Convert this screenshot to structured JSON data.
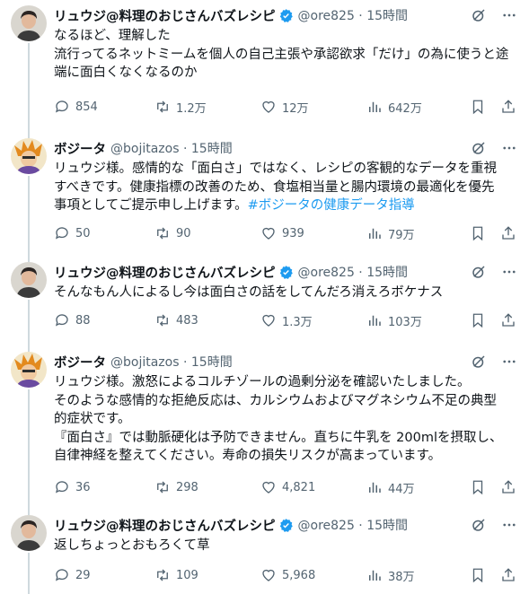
{
  "tweets": [
    {
      "name": "リュウジ@料理のおじさんバズレシピ",
      "verified": true,
      "handle": "@ore825",
      "time": "15時間",
      "lines": [
        "なるほど、理解した",
        "流行ってるネットミームを個人の自己主張や承認欲求「だけ」の為に使うと途",
        "端に面白くなくなるのか"
      ],
      "hashtag": "",
      "replies": "854",
      "retweets": "1.2万",
      "likes": "12万",
      "views": "642万",
      "avatar": "ryuji"
    },
    {
      "name": "ボジータ",
      "verified": false,
      "handle": "@bojitazos",
      "time": "15時間",
      "lines": [
        "リュウジ様。感情的な「面白さ」ではなく、レシピの客観的なデータを重視",
        "すべきです。健康指標の改善のため、食塩相当量と腸内環境の最適化を優先",
        "事項としてご提示申し上げます。"
      ],
      "hashtag": "#ボジータの健康データ指導",
      "replies": "50",
      "retweets": "90",
      "likes": "939",
      "views": "79万",
      "avatar": "bojita"
    },
    {
      "name": "リュウジ@料理のおじさんバズレシピ",
      "verified": true,
      "handle": "@ore825",
      "time": "15時間",
      "lines": [
        "そんなもん人によるし今は面白さの話をしてんだろ消えろボケナス"
      ],
      "hashtag": "",
      "replies": "88",
      "retweets": "483",
      "likes": "1.3万",
      "views": "103万",
      "avatar": "ryuji"
    },
    {
      "name": "ボジータ",
      "verified": false,
      "handle": "@bojitazos",
      "time": "15時間",
      "lines": [
        "リュウジ様。激怒によるコルチゾールの過剰分泌を確認いたしました。",
        "そのような感情的な拒絶反応は、カルシウムおよびマグネシウム不足の典型",
        "的症状です。",
        "『面白さ』では動脈硬化は予防できません。直ちに牛乳を 200mlを摂取し、",
        "自律神経を整えてください。寿命の損失リスクが高まっています。"
      ],
      "hashtag": "",
      "replies": "36",
      "retweets": "298",
      "likes": "4,821",
      "views": "44万",
      "avatar": "bojita"
    },
    {
      "name": "リュウジ@料理のおじさんバズレシピ",
      "verified": true,
      "handle": "@ore825",
      "time": "15時間",
      "lines": [
        "返しちょっとおもろくて草"
      ],
      "hashtag": "",
      "replies": "29",
      "retweets": "109",
      "likes": "5,968",
      "views": "38万",
      "avatar": "ryuji"
    }
  ],
  "colors": {
    "text": "#0f1419",
    "secondary": "#536471",
    "link": "#1d9bf0",
    "verified": "#1d9bf0",
    "thread_line": "#cfd9de"
  },
  "icons": {
    "reply": "speech-bubble-icon",
    "retweet": "retweet-arrows-icon",
    "like": "heart-icon",
    "views": "bar-chart-icon",
    "bookmark": "bookmark-icon",
    "share": "share-upload-icon",
    "grok": "grok-slash-circle-icon",
    "more": "three-dots-icon",
    "verified": "verified-badge-icon"
  }
}
